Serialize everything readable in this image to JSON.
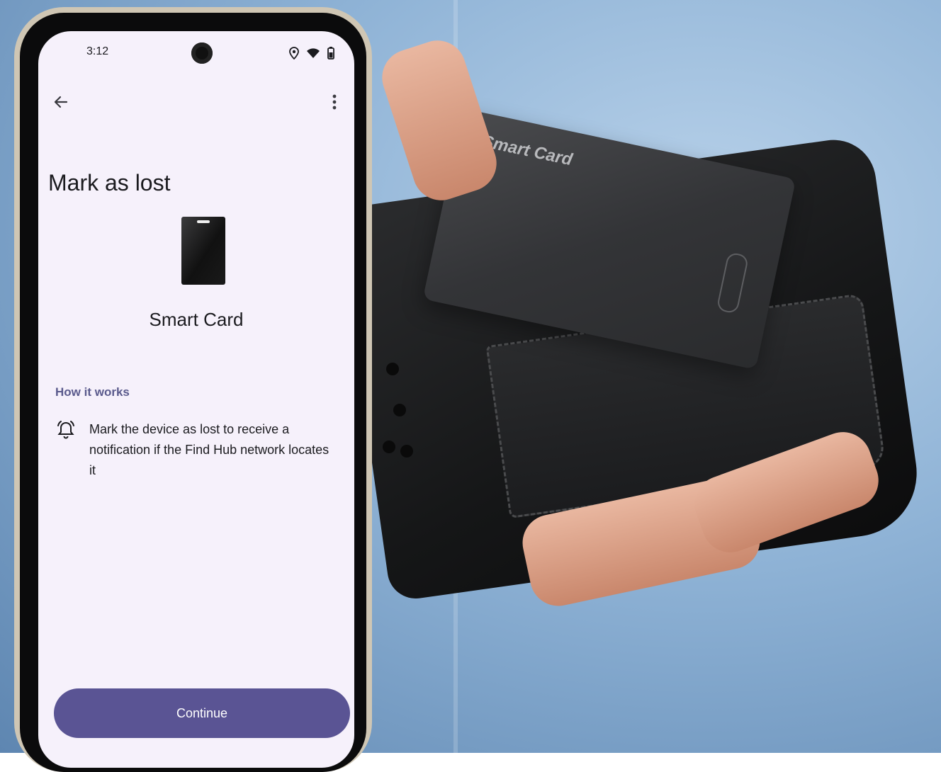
{
  "status_bar": {
    "time": "3:12"
  },
  "screen": {
    "title": "Mark as lost",
    "device_name": "Smart Card",
    "section_label": "How it works",
    "info_text": "Mark the device as lost to receive a notification if the Find Hub network locates it",
    "continue_label": "Continue"
  },
  "product_card": {
    "label": "Smart Card"
  },
  "colors": {
    "primary_button": "#5a5494",
    "section_label": "#5a5a8c",
    "screen_bg": "#f6f1fb"
  },
  "icons": {
    "back": "arrow-back-icon",
    "more": "more-vert-icon",
    "alarm": "alarm-bell-icon",
    "location": "location-icon",
    "wifi": "wifi-icon",
    "battery": "battery-icon"
  }
}
